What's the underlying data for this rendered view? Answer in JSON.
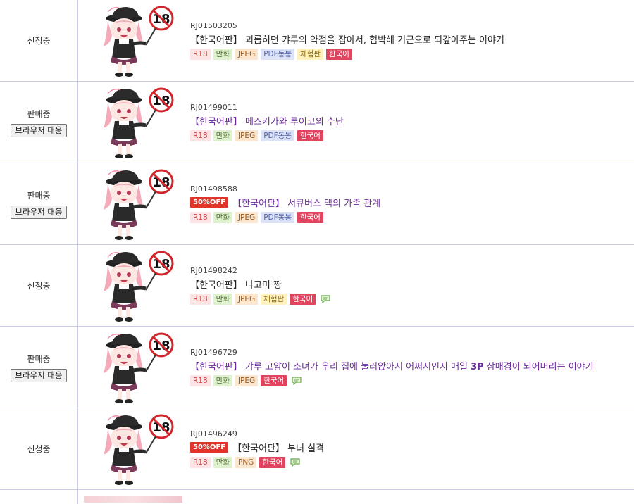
{
  "works": [
    {
      "status": "신청중",
      "browser_button": null,
      "rj": "RJ01503205",
      "sale": null,
      "title": "【한국어판】 괴롭히던 갸루의 약점을 잡아서, 협박해 거근으로 되갚아주는 이야기",
      "title_bold": null,
      "title_after": null,
      "link": false,
      "tags": [
        [
          "R18",
          "t-r18"
        ],
        [
          "만화",
          "t-manga"
        ],
        [
          "JPEG",
          "t-jpeg"
        ],
        [
          "PDF동봉",
          "t-pdf"
        ],
        [
          "체험판",
          "t-trial"
        ],
        [
          "한국어",
          "t-ko"
        ]
      ],
      "chat": false
    },
    {
      "status": "판매중",
      "browser_button": "브라우저 대응",
      "rj": "RJ01499011",
      "sale": null,
      "title": "【한국어판】 메즈키가와 루이코의 수난",
      "title_bold": null,
      "title_after": null,
      "link": true,
      "tags": [
        [
          "R18",
          "t-r18"
        ],
        [
          "만화",
          "t-manga"
        ],
        [
          "JPEG",
          "t-jpeg"
        ],
        [
          "PDF동봉",
          "t-pdf"
        ],
        [
          "한국어",
          "t-ko"
        ]
      ],
      "chat": false
    },
    {
      "status": "판매중",
      "browser_button": "브라우저 대응",
      "rj": "RJ01498588",
      "sale": "50%OFF",
      "title": "【한국어판】 서큐버스 댁의 가족 관계",
      "title_bold": null,
      "title_after": null,
      "link": true,
      "tags": [
        [
          "R18",
          "t-r18"
        ],
        [
          "만화",
          "t-manga"
        ],
        [
          "JPEG",
          "t-jpeg"
        ],
        [
          "PDF동봉",
          "t-pdf"
        ],
        [
          "한국어",
          "t-ko"
        ]
      ],
      "chat": false
    },
    {
      "status": "신청중",
      "browser_button": null,
      "rj": "RJ01498242",
      "sale": null,
      "title": "【한국어판】 나고미 쨩",
      "title_bold": null,
      "title_after": null,
      "link": false,
      "tags": [
        [
          "R18",
          "t-r18"
        ],
        [
          "만화",
          "t-manga"
        ],
        [
          "JPEG",
          "t-jpeg"
        ],
        [
          "체험판",
          "t-trial"
        ],
        [
          "한국어",
          "t-ko"
        ]
      ],
      "chat": true
    },
    {
      "status": "판매중",
      "browser_button": "브라우저 대응",
      "rj": "RJ01496729",
      "sale": null,
      "title": "【한국어판】 갸루 고양이 소녀가 우리 집에 눌러앉아서 어쩌서인지 매일 ",
      "title_bold": "3P",
      "title_after": " 삼매경이 되어버리는 이야기",
      "link": true,
      "tags": [
        [
          "R18",
          "t-r18"
        ],
        [
          "만화",
          "t-manga"
        ],
        [
          "JPEG",
          "t-jpeg"
        ],
        [
          "한국어",
          "t-ko"
        ]
      ],
      "chat": true
    },
    {
      "status": "신청중",
      "browser_button": null,
      "rj": "RJ01496249",
      "sale": "50%OFF",
      "title": "【한국어판】 부녀 실격",
      "title_bold": null,
      "title_after": null,
      "link": false,
      "tags": [
        [
          "R18",
          "t-r18"
        ],
        [
          "만화",
          "t-manga"
        ],
        [
          "PNG",
          "t-png"
        ],
        [
          "한국어",
          "t-ko"
        ]
      ],
      "chat": true
    }
  ],
  "thumbnail_icon": "age-restricted-mascot-icon",
  "age_badge_text": "18",
  "colors": {
    "row_border": "#c9cbe0",
    "link_title": "#6a2a9a",
    "sale_badge": "#e0352f",
    "korean_tag": "#e0455f"
  }
}
